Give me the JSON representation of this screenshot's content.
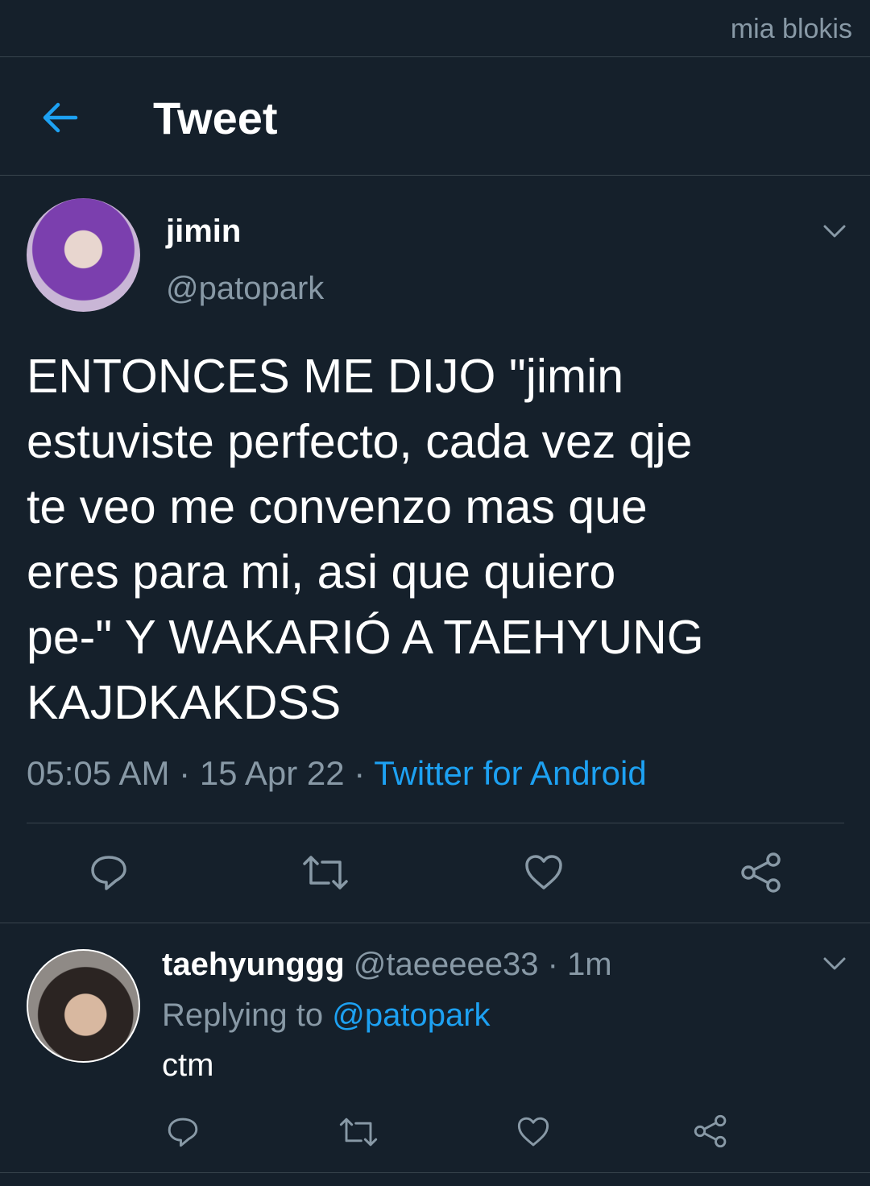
{
  "status_bar": {
    "owner_label": "mia blokis"
  },
  "header": {
    "title": "Tweet",
    "back_icon": "arrow-left-icon"
  },
  "tweet": {
    "author_name": "jimin",
    "author_handle": "@patopark",
    "text": "ENTONCES ME DIJO \"jimin\nestuviste perfecto, cada vez qje\nte veo me convenzo mas que\neres para mi, asi que quiero\npe-\" Y WAKARIÓ A TAEHYUNG\nKAJDKAKDSS",
    "time": "05:05 AM",
    "date": "15 Apr 22",
    "dot": "·",
    "source": "Twitter for Android",
    "actions": [
      "reply-icon",
      "retweet-icon",
      "like-icon",
      "share-icon"
    ]
  },
  "reply": {
    "author_name": "taehyunggg",
    "author_handle": "@taeeeee33",
    "time_ago": "1m",
    "dot": "·",
    "replying_prefix": "Replying to",
    "replying_to": "@patopark",
    "text": "ctm",
    "actions": [
      "reply-icon",
      "retweet-icon",
      "like-icon",
      "share-icon"
    ]
  },
  "colors": {
    "background": "#15202b",
    "accent": "#1da1f2",
    "muted": "#8899a6",
    "divider": "#38444d"
  }
}
